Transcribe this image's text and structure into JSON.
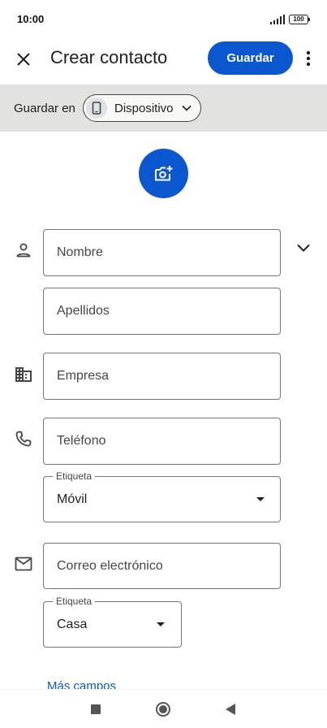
{
  "status_bar": {
    "time": "10:00",
    "battery": "100"
  },
  "header": {
    "title": "Crear contacto",
    "save_label": "Guardar"
  },
  "save_in": {
    "label": "Guardar en",
    "device": "Dispositivo"
  },
  "form": {
    "first_name_placeholder": "Nombre",
    "last_name_placeholder": "Apellidos",
    "company_placeholder": "Empresa",
    "phone_placeholder": "Teléfono",
    "phone_label_legend": "Etiqueta",
    "phone_label_value": "Móvil",
    "email_placeholder": "Correo electrónico",
    "email_label_legend": "Etiqueta",
    "email_label_value": "Casa"
  },
  "more_fields_label": "Más campos",
  "colors": {
    "accent": "#0b57d0",
    "banner": "#e2e3e1"
  }
}
